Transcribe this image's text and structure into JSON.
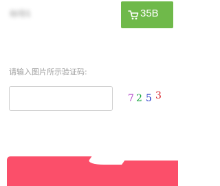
{
  "header": {
    "username_obscured": "帐号1",
    "price": {
      "icon": "cart-icon",
      "label": "35B"
    }
  },
  "captcha": {
    "prompt": "请输入图片所示验证码:",
    "input_value": "",
    "input_placeholder": "",
    "digits": [
      "7",
      "2",
      "5",
      "3"
    ],
    "digit_colors": [
      "#b044c7",
      "#16a43d",
      "#1f33c9",
      "#d8222a"
    ]
  },
  "colors": {
    "accent_green": "#6fb94a",
    "submit_pink": "#fb4f6a"
  }
}
